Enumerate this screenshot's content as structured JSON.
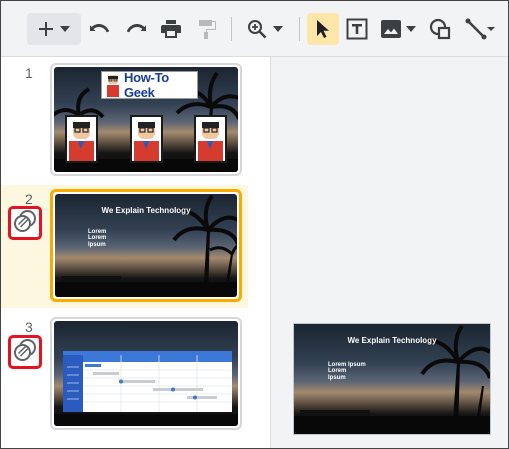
{
  "toolbar": {
    "icons": [
      "add-icon",
      "chevron-down-icon",
      "undo-icon",
      "redo-icon",
      "print-icon",
      "paint-format-icon",
      "zoom-icon",
      "chevron-down-icon",
      "select-cursor-icon",
      "text-box-icon",
      "image-icon",
      "chevron-down-icon",
      "shape-icon",
      "line-icon"
    ]
  },
  "slides": [
    {
      "number": "1",
      "banner_text": "How-To Geek"
    },
    {
      "number": "2",
      "title": "We Explain Technology",
      "body": [
        "Lorem",
        "Lorem",
        "Ipsum"
      ]
    },
    {
      "number": "3"
    }
  ],
  "canvas": {
    "title": "We Explain Technology",
    "body": [
      "Lorem Ipsum",
      "Lorem",
      "Ipsum"
    ]
  },
  "colors": {
    "accent_selected": "#f9ab00",
    "link_highlight": "#e5121f",
    "toolbar_bg": "#f1f3f4"
  }
}
